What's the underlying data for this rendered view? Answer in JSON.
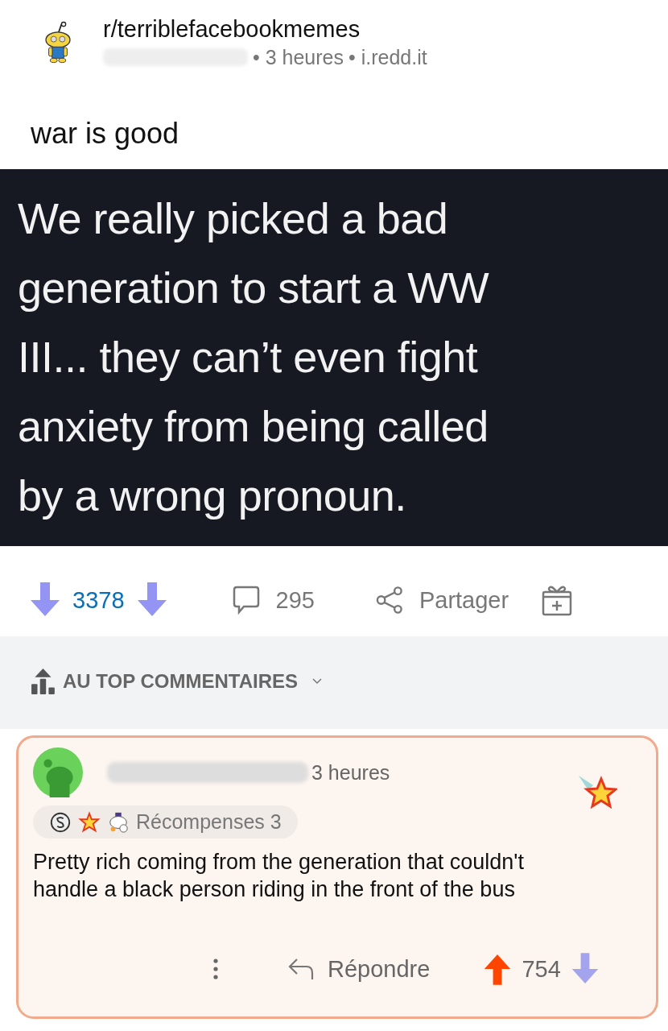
{
  "post": {
    "subreddit": "r/terriblefacebookmemes",
    "time": "• 3 heures",
    "domain": "• i.redd.it",
    "title": "war is good",
    "image_text": [
      "We really picked a bad",
      "generation to start a WW",
      "III... they can’t even fight",
      "anxiety from being called",
      "by a wrong pronoun."
    ],
    "upvoted": false,
    "downvoted": true,
    "score": "3378",
    "comments": "295",
    "share": "Partager"
  },
  "sort": {
    "label": "AU TOP COMMENTAIRES"
  },
  "comment": {
    "highlighted": true,
    "time": "3 heures",
    "awards": "Récompenses 3",
    "body": "Pretty rich coming from the generation that couldn't handle a black person riding in the front of the bus",
    "reply": "Répondre",
    "upvoted": true,
    "downvoted": false,
    "score": "754"
  }
}
